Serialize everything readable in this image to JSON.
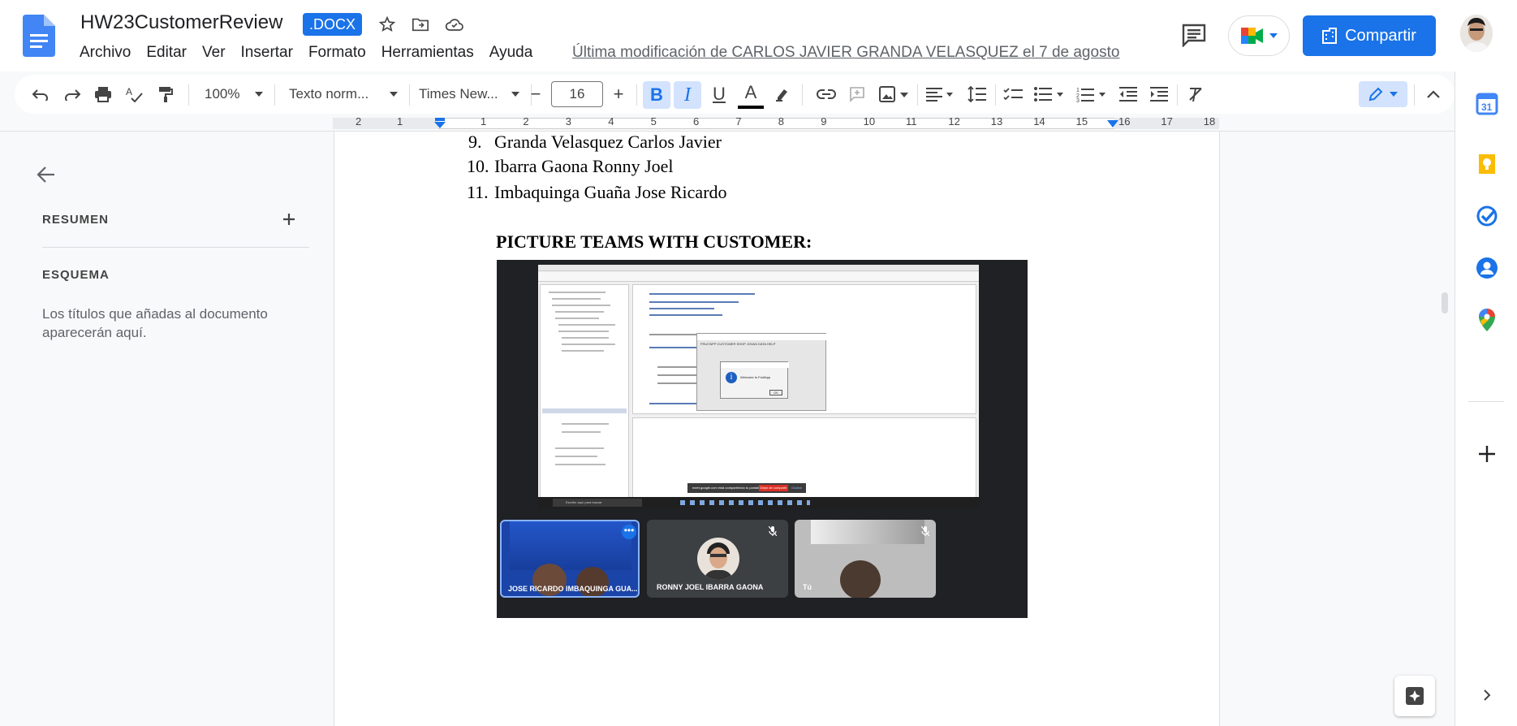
{
  "header": {
    "title": "HW23CustomerReview",
    "badge": ".DOCX",
    "menu": [
      "Archivo",
      "Editar",
      "Ver",
      "Insertar",
      "Formato",
      "Herramientas",
      "Ayuda"
    ],
    "last_modified": "Última modificación de CARLOS JAVIER GRANDA VELASQUEZ el 7 de agosto",
    "share_label": "Compartir"
  },
  "toolbar": {
    "zoom": "100%",
    "style": "Texto norm...",
    "font": "Times New...",
    "font_size": "16",
    "bold_label": "B",
    "italic_label": "I",
    "underline_label": "U",
    "text_color_label": "A",
    "decrease_label": "−",
    "increase_label": "+"
  },
  "ruler": {
    "numbers": [
      "2",
      "1",
      "1",
      "2",
      "3",
      "4",
      "5",
      "6",
      "7",
      "8",
      "9",
      "10",
      "11",
      "12",
      "13",
      "14",
      "15",
      "16",
      "17",
      "18"
    ]
  },
  "outline": {
    "summary_label": "RESUMEN",
    "outline_label": "ESQUEMA",
    "empty_text": "Los títulos que añadas al documento aparecerán aquí."
  },
  "document": {
    "list_items": [
      {
        "num": "9.",
        "text": "Granda Velasquez Carlos Javier"
      },
      {
        "num": "10.",
        "text": "Ibarra Gaona Ronny Joel"
      },
      {
        "num": "11.",
        "text": "Imbaquinga Guaña Jose Ricardo"
      }
    ],
    "heading": "PICTURE TEAMS WITH CUSTOMER:"
  },
  "embedded_image": {
    "participants": [
      "JOSE RICARDO IMBAQUINGA GUA...",
      "RONNY JOEL IBARRA GAONA",
      "Tú"
    ],
    "dialog_text": "Welcome to FruitApp",
    "dialog_ok": "OK",
    "window_title": "FRUITAPP CUSTOMER SHOP JOVAN DATA HELP",
    "screen_share_notice": "meet.google.com está compartiendo tu pantalla",
    "stop_share": "Dejar de compartir",
    "hide": "Ocultar",
    "search_placeholder": "Escribe aquí para buscar"
  },
  "colors": {
    "accent": "#1a73e8",
    "doc_blue": "#4285f4"
  }
}
